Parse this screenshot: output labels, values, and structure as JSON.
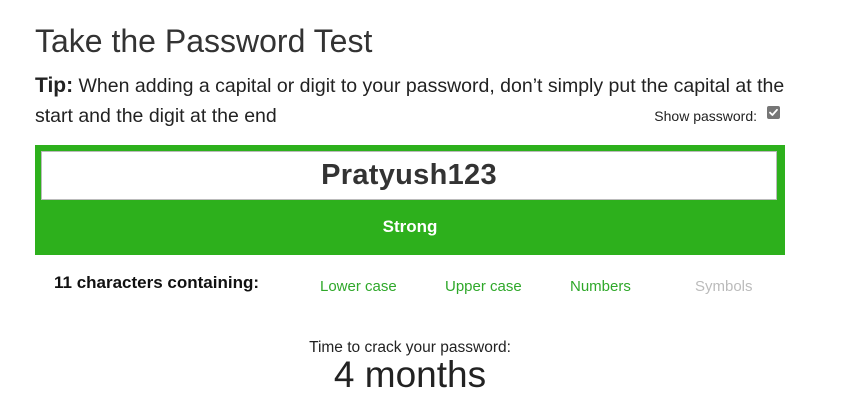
{
  "page": {
    "title": "Take the Password Test"
  },
  "tip": {
    "label": "Tip:",
    "text": "When adding a capital or digit to your password, don’t simply put the capital at the start and the digit at the end"
  },
  "show_password": {
    "label": "Show password:",
    "checked": true
  },
  "password_field": {
    "value": "Pratyush123"
  },
  "strength": {
    "label": "Strength",
    "value": "Strong",
    "color": "#2db01c"
  },
  "characters": {
    "summary": "11 characters containing:",
    "criteria": [
      {
        "label": "Lower case",
        "met": true,
        "color": "#2fa82a"
      },
      {
        "label": "Upper case",
        "met": true,
        "color": "#2fa82a"
      },
      {
        "label": "Numbers",
        "met": true,
        "color": "#2fa82a"
      },
      {
        "label": "Symbols",
        "met": false,
        "color": "#bbbbbb"
      }
    ]
  },
  "crack": {
    "label": "Time to crack your password:",
    "value": "4 months"
  }
}
